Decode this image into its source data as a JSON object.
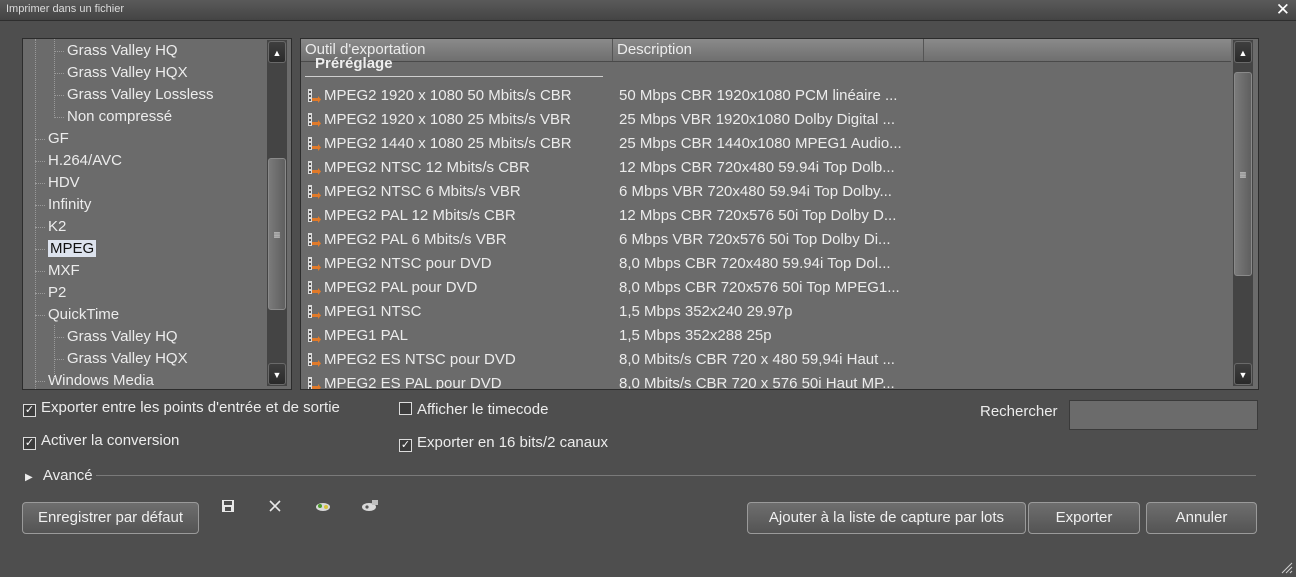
{
  "window": {
    "title": "Imprimer dans un fichier",
    "close_glyph": "✕"
  },
  "tree": {
    "items": [
      {
        "label": "Grass Valley HQ",
        "level": 2
      },
      {
        "label": "Grass Valley HQX",
        "level": 2
      },
      {
        "label": "Grass Valley Lossless",
        "level": 2
      },
      {
        "label": "Non compressé",
        "level": 2
      },
      {
        "label": "GF",
        "level": 1
      },
      {
        "label": "H.264/AVC",
        "level": 1
      },
      {
        "label": "HDV",
        "level": 1
      },
      {
        "label": "Infinity",
        "level": 1
      },
      {
        "label": "K2",
        "level": 1
      },
      {
        "label": "MPEG",
        "level": 1,
        "selected": true
      },
      {
        "label": "MXF",
        "level": 1
      },
      {
        "label": "P2",
        "level": 1
      },
      {
        "label": "QuickTime",
        "level": 1
      },
      {
        "label": "Grass Valley HQ",
        "level": 2
      },
      {
        "label": "Grass Valley HQX",
        "level": 2
      },
      {
        "label": "Windows Media",
        "level": 1
      }
    ]
  },
  "list": {
    "columns": [
      "Outil d'exportation",
      "Description"
    ],
    "group": "Préréglage",
    "rows": [
      {
        "name": "MPEG2 1920 x 1080 50 Mbits/s CBR",
        "desc": "50 Mbps CBR 1920x1080 PCM linéaire ..."
      },
      {
        "name": "MPEG2 1920 x 1080 25 Mbits/s VBR",
        "desc": "25 Mbps VBR 1920x1080 Dolby Digital ..."
      },
      {
        "name": "MPEG2 1440 x 1080 25 Mbits/s CBR",
        "desc": "25 Mbps CBR 1440x1080 MPEG1 Audio..."
      },
      {
        "name": "MPEG2 NTSC 12 Mbits/s CBR",
        "desc": "12 Mbps CBR 720x480 59.94i Top Dolb..."
      },
      {
        "name": "MPEG2 NTSC 6 Mbits/s VBR",
        "desc": "6 Mbps VBR 720x480 59.94i Top Dolby..."
      },
      {
        "name": "MPEG2 PAL 12 Mbits/s CBR",
        "desc": "12 Mbps CBR 720x576 50i Top Dolby D..."
      },
      {
        "name": "MPEG2 PAL 6 Mbits/s VBR",
        "desc": "6 Mbps VBR 720x576 50i Top Dolby Di..."
      },
      {
        "name": "MPEG2 NTSC pour DVD",
        "desc": "8,0 Mbps CBR 720x480 59.94i Top Dol..."
      },
      {
        "name": "MPEG2 PAL pour DVD",
        "desc": "8,0 Mbps CBR 720x576 50i Top MPEG1..."
      },
      {
        "name": "MPEG1 NTSC",
        "desc": "1,5 Mbps 352x240 29.97p"
      },
      {
        "name": "MPEG1 PAL",
        "desc": "1,5 Mbps 352x288 25p"
      },
      {
        "name": "MPEG2 ES NTSC pour DVD",
        "desc": "8,0 Mbits/s CBR 720 x 480 59,94i Haut ..."
      },
      {
        "name": "MPEG2 ES PAL pour DVD",
        "desc": "8,0 Mbits/s CBR 720 x 576 50i Haut MP..."
      }
    ]
  },
  "options": {
    "export_in_out": {
      "label": "Exporter entre les points d'entrée et de sortie",
      "checked": true
    },
    "conversion": {
      "label": "Activer la conversion",
      "checked": true
    },
    "timecode": {
      "label": "Afficher le timecode",
      "checked": false
    },
    "audio16": {
      "label": "Exporter en 16 bits/2 canaux",
      "checked": true
    },
    "search_label": "Rechercher",
    "search_value": "",
    "advanced": "Avancé"
  },
  "buttons": {
    "save_default": "Enregistrer par défaut",
    "add_batch": "Ajouter à la liste de capture par lots",
    "export": "Exporter",
    "cancel": "Annuler"
  },
  "colors": {
    "accent_icon": "#e07a2a",
    "bg": "#4e4e4e",
    "panel": "#6b6b6b"
  }
}
